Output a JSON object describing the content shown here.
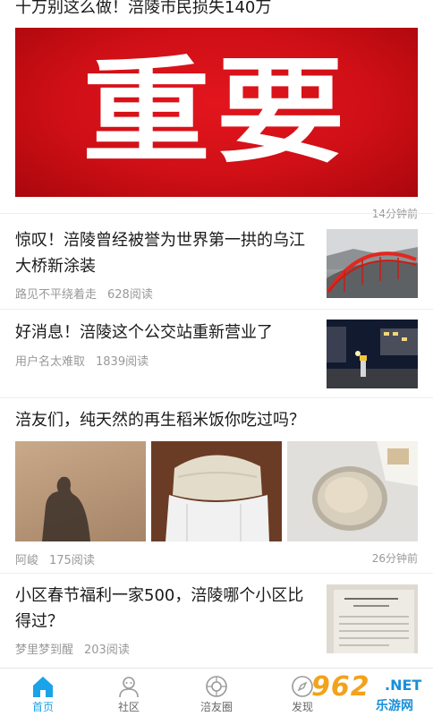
{
  "feed": {
    "top_article": {
      "title": "十万别这么做！涪陵市民损失140万",
      "banner_text": "重要",
      "time": "14分钟前"
    },
    "articles": [
      {
        "title": "惊叹！涪陵曾经被誉为世界第一拱的乌江大桥新涂装",
        "author": "路见不平绕着走",
        "reads": "628阅读"
      },
      {
        "title": "好消息！涪陵这个公交站重新营业了",
        "author": "用户名太难取",
        "reads": "1839阅读"
      },
      {
        "title": "涪友们，纯天然的再生稻米饭你吃过吗？",
        "author": "阿峻",
        "reads": "175阅读",
        "time": "26分钟前"
      },
      {
        "title": "小区春节福利一家500，涪陵哪个小区比得过？",
        "author": "梦里梦到醒",
        "reads": "203阅读"
      }
    ]
  },
  "tabbar": {
    "tabs": [
      {
        "label": "首页",
        "icon": "home-icon",
        "active": true
      },
      {
        "label": "社区",
        "icon": "community-icon",
        "active": false
      },
      {
        "label": "涪友圈",
        "icon": "friends-circle-icon",
        "active": false
      },
      {
        "label": "发现",
        "icon": "discover-icon",
        "active": false
      }
    ]
  },
  "watermark": {
    "num": "962",
    "net": ".NET",
    "site": "乐游网"
  },
  "colors": {
    "accent": "#1aa3e8",
    "banner_red": "#d3121a",
    "meta_gray": "#999999"
  }
}
